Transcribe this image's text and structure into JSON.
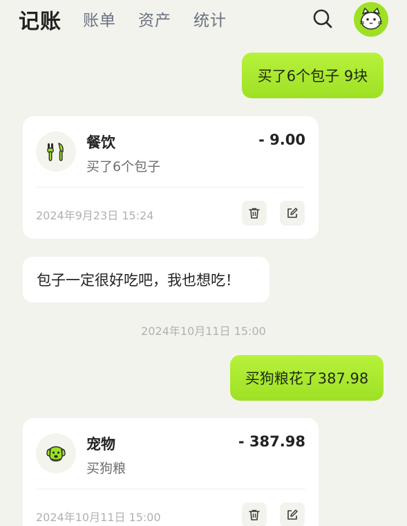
{
  "header": {
    "tabs": [
      {
        "label": "记账",
        "active": true
      },
      {
        "label": "账单",
        "active": false
      },
      {
        "label": "资产",
        "active": false
      },
      {
        "label": "统计",
        "active": false
      }
    ],
    "search_icon": "search-icon",
    "avatar_icon": "cat-avatar-icon"
  },
  "messages": {
    "user_1": "买了6个包子 9块",
    "record_1": {
      "category": "餐饮",
      "note": "买了6个包子",
      "amount": "- 9.00",
      "time": "2024年9月23日 15:24",
      "icon": "fork-knife-icon"
    },
    "bot_1": "包子一定很好吃吧，我也想吃！",
    "divider_time": "2024年10月11日 15:00",
    "user_2": "买狗粮花了387.98",
    "record_2": {
      "category": "宠物",
      "note": "买狗粮",
      "amount": "- 387.98",
      "time": "2024年10月11日 15:00",
      "icon": "dog-icon"
    }
  },
  "colors": {
    "accent": "#9ee024",
    "background": "#f3f3ee",
    "card": "#ffffff",
    "muted_text": "#b0b0b0"
  }
}
